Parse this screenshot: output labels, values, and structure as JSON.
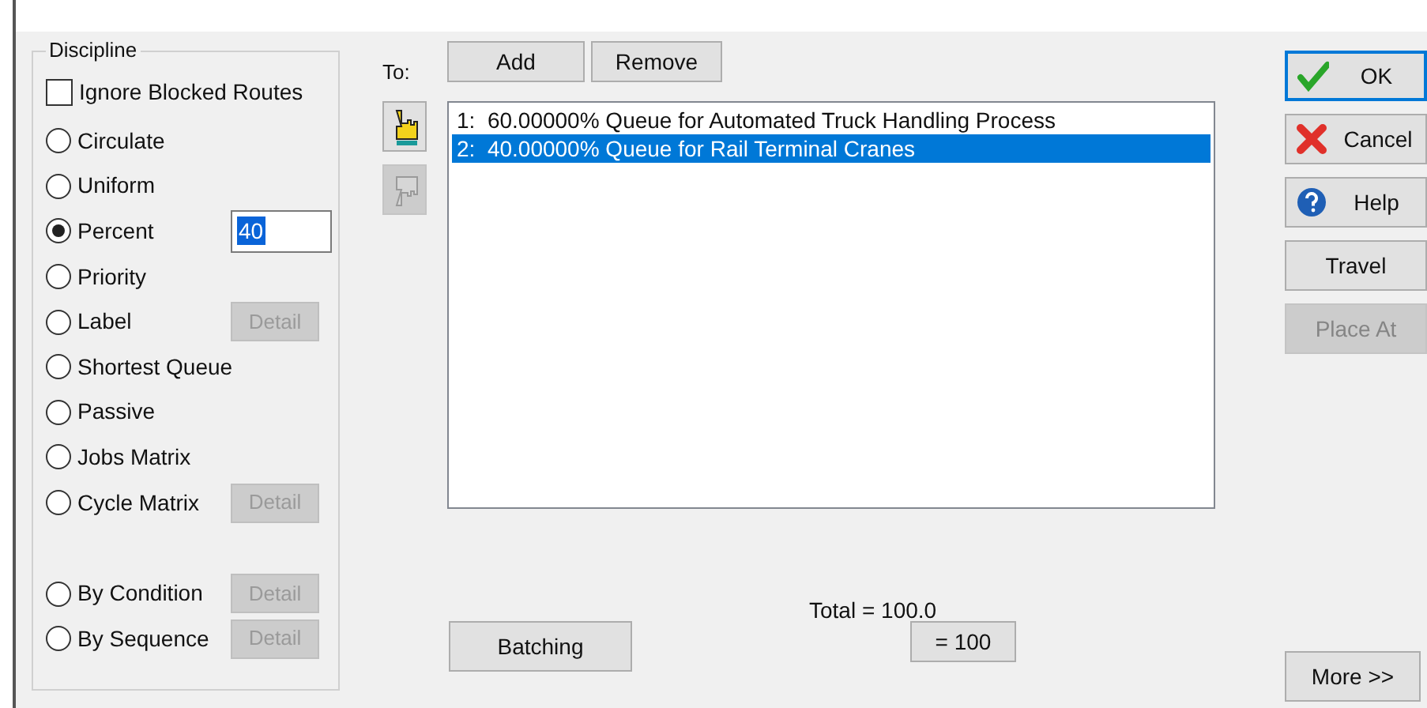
{
  "discipline": {
    "title": "Discipline",
    "ignore_blocked": {
      "label": "Ignore Blocked Routes",
      "checked": false
    },
    "options": [
      {
        "label": "Circulate",
        "selected": false
      },
      {
        "label": "Uniform",
        "selected": false
      },
      {
        "label": "Percent",
        "selected": true,
        "field": {
          "value": "40",
          "highlighted": true
        }
      },
      {
        "label": "Priority",
        "selected": false
      },
      {
        "label": "Label",
        "selected": false,
        "detail": {
          "label": "Detail",
          "disabled": true
        }
      },
      {
        "label": "Shortest Queue",
        "selected": false
      },
      {
        "label": "Passive",
        "selected": false
      },
      {
        "label": "Jobs Matrix",
        "selected": false
      },
      {
        "label": "Cycle Matrix",
        "selected": false,
        "detail": {
          "label": "Detail",
          "disabled": true
        }
      }
    ],
    "conditional_options": [
      {
        "label": "By Condition",
        "selected": false,
        "detail": {
          "label": "Detail",
          "disabled": true
        }
      },
      {
        "label": "By Sequence",
        "selected": false,
        "detail": {
          "label": "Detail",
          "disabled": true
        }
      }
    ]
  },
  "to": {
    "label": "To:",
    "buttons": [
      {
        "label": "Add"
      },
      {
        "label": "Remove"
      }
    ],
    "pointers": [
      {
        "kind": "up",
        "disabled": false
      },
      {
        "kind": "down",
        "disabled": true
      }
    ],
    "list": [
      {
        "number": "1:",
        "text": "60.00000% Queue for Automated Truck Handling Process",
        "selected": false
      },
      {
        "number": "2:",
        "text": "40.00000% Queue for Rail Terminal Cranes",
        "selected": true
      }
    ]
  },
  "batching": {
    "label": "Batching"
  },
  "total": {
    "text": "Total = 100.0",
    "button": "= 100"
  },
  "side_buttons": [
    {
      "label": "OK",
      "kind": "ok",
      "default": true,
      "disabled": false
    },
    {
      "label": "Cancel",
      "kind": "cancel",
      "default": false,
      "disabled": false
    },
    {
      "label": "Help",
      "kind": "help",
      "default": false,
      "disabled": false
    },
    {
      "label": "Travel",
      "kind": "plain",
      "default": false,
      "disabled": false
    },
    {
      "label": "Place At",
      "kind": "plain",
      "default": false,
      "disabled": true
    }
  ],
  "more": {
    "label": "More >>"
  }
}
